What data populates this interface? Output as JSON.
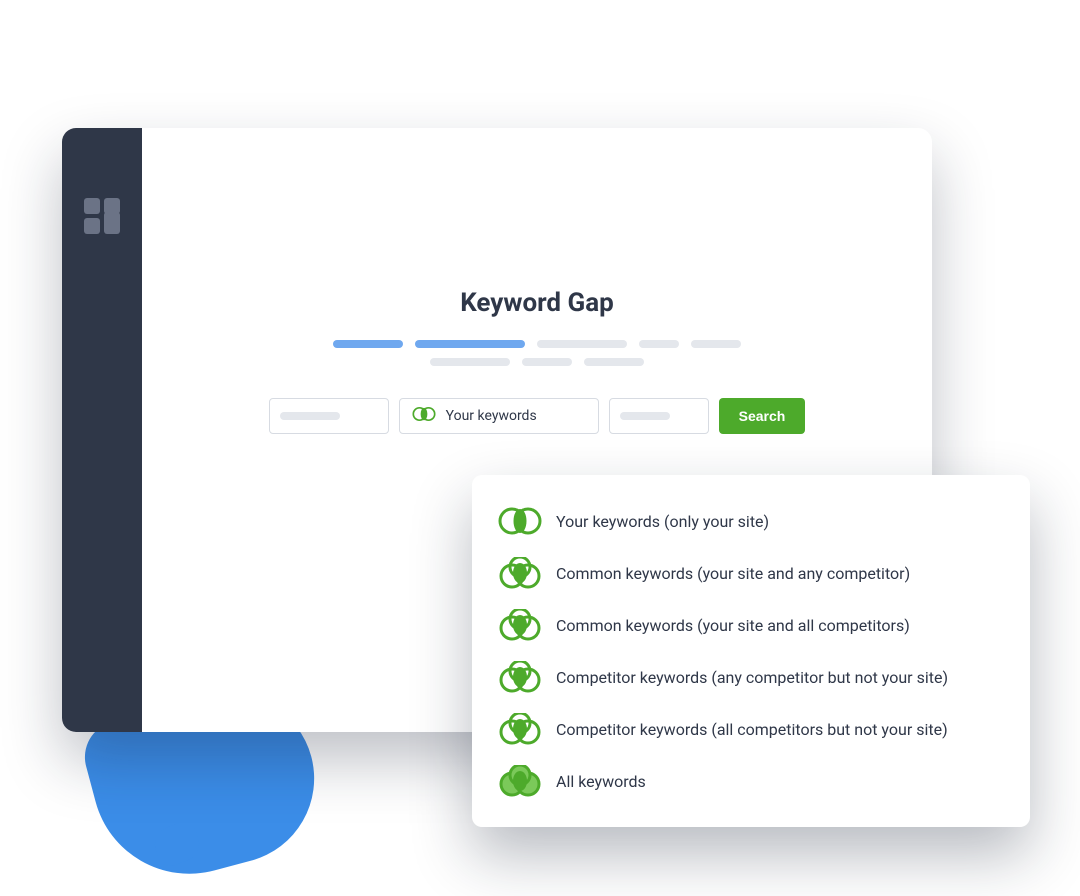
{
  "page": {
    "title": "Keyword Gap"
  },
  "form": {
    "your_keywords_label": "Your keywords",
    "search_button": "Search"
  },
  "dropdown": {
    "items": [
      {
        "label": "Your keywords (only your site)"
      },
      {
        "label": "Common keywords (your site and any competitor)"
      },
      {
        "label": "Common keywords (your site and all competitors)"
      },
      {
        "label": "Competitor keywords (any competitor but not your site)"
      },
      {
        "label": "Competitor keywords (all competitors but not your site)"
      },
      {
        "label": "All keywords"
      }
    ]
  }
}
